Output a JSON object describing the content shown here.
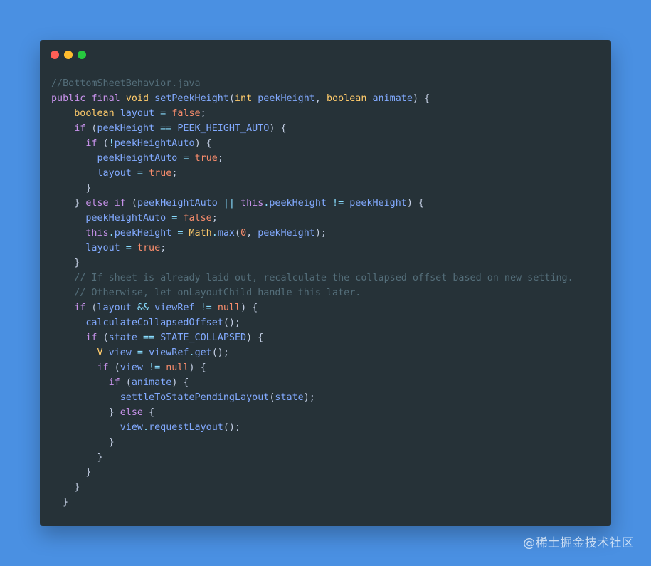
{
  "window": {
    "controls": [
      {
        "name": "close",
        "color": "#ff5f56"
      },
      {
        "name": "minimize",
        "color": "#ffbd2e"
      },
      {
        "name": "maximize",
        "color": "#27c93f"
      }
    ],
    "code_lines": [
      [
        {
          "t": "//BottomSheetBehavior.java",
          "s": "c"
        }
      ],
      [
        {
          "t": "public",
          "s": "k"
        },
        {
          "t": " "
        },
        {
          "t": "final",
          "s": "k"
        },
        {
          "t": " "
        },
        {
          "t": "void",
          "s": "t"
        },
        {
          "t": " "
        },
        {
          "t": "setPeekHeight",
          "s": "f"
        },
        {
          "t": "(",
          "s": "d"
        },
        {
          "t": "int",
          "s": "t"
        },
        {
          "t": " "
        },
        {
          "t": "peekHeight",
          "s": "v"
        },
        {
          "t": ", ",
          "s": "d"
        },
        {
          "t": "boolean",
          "s": "t"
        },
        {
          "t": " "
        },
        {
          "t": "animate",
          "s": "v"
        },
        {
          "t": ") {",
          "s": "d"
        }
      ],
      [
        {
          "t": "    "
        },
        {
          "t": "boolean",
          "s": "t"
        },
        {
          "t": " "
        },
        {
          "t": "layout",
          "s": "v"
        },
        {
          "t": " = ",
          "s": "p"
        },
        {
          "t": "false",
          "s": "n"
        },
        {
          "t": ";",
          "s": "d"
        }
      ],
      [
        {
          "t": "    "
        },
        {
          "t": "if",
          "s": "k"
        },
        {
          "t": " (",
          "s": "d"
        },
        {
          "t": "peekHeight",
          "s": "v"
        },
        {
          "t": " == ",
          "s": "p"
        },
        {
          "t": "PEEK_HEIGHT_AUTO",
          "s": "v"
        },
        {
          "t": ") {",
          "s": "d"
        }
      ],
      [
        {
          "t": "      "
        },
        {
          "t": "if",
          "s": "k"
        },
        {
          "t": " (",
          "s": "d"
        },
        {
          "t": "!",
          "s": "p"
        },
        {
          "t": "peekHeightAuto",
          "s": "v"
        },
        {
          "t": ") {",
          "s": "d"
        }
      ],
      [
        {
          "t": "        "
        },
        {
          "t": "peekHeightAuto",
          "s": "v"
        },
        {
          "t": " = ",
          "s": "p"
        },
        {
          "t": "true",
          "s": "n"
        },
        {
          "t": ";",
          "s": "d"
        }
      ],
      [
        {
          "t": "        "
        },
        {
          "t": "layout",
          "s": "v"
        },
        {
          "t": " = ",
          "s": "p"
        },
        {
          "t": "true",
          "s": "n"
        },
        {
          "t": ";",
          "s": "d"
        }
      ],
      [
        {
          "t": "      "
        },
        {
          "t": "}",
          "s": "d"
        }
      ],
      [
        {
          "t": "    "
        },
        {
          "t": "} ",
          "s": "d"
        },
        {
          "t": "else",
          "s": "k"
        },
        {
          "t": " "
        },
        {
          "t": "if",
          "s": "k"
        },
        {
          "t": " (",
          "s": "d"
        },
        {
          "t": "peekHeightAuto",
          "s": "v"
        },
        {
          "t": " || ",
          "s": "p"
        },
        {
          "t": "this",
          "s": "k"
        },
        {
          "t": ".",
          "s": "p"
        },
        {
          "t": "peekHeight",
          "s": "v"
        },
        {
          "t": " != ",
          "s": "p"
        },
        {
          "t": "peekHeight",
          "s": "v"
        },
        {
          "t": ") {",
          "s": "d"
        }
      ],
      [
        {
          "t": "      "
        },
        {
          "t": "peekHeightAuto",
          "s": "v"
        },
        {
          "t": " = ",
          "s": "p"
        },
        {
          "t": "false",
          "s": "n"
        },
        {
          "t": ";",
          "s": "d"
        }
      ],
      [
        {
          "t": "      "
        },
        {
          "t": "this",
          "s": "k"
        },
        {
          "t": ".",
          "s": "p"
        },
        {
          "t": "peekHeight",
          "s": "v"
        },
        {
          "t": " = ",
          "s": "p"
        },
        {
          "t": "Math",
          "s": "t"
        },
        {
          "t": ".",
          "s": "p"
        },
        {
          "t": "max",
          "s": "f"
        },
        {
          "t": "(",
          "s": "d"
        },
        {
          "t": "0",
          "s": "n"
        },
        {
          "t": ", ",
          "s": "d"
        },
        {
          "t": "peekHeight",
          "s": "v"
        },
        {
          "t": ");",
          "s": "d"
        }
      ],
      [
        {
          "t": "      "
        },
        {
          "t": "layout",
          "s": "v"
        },
        {
          "t": " = ",
          "s": "p"
        },
        {
          "t": "true",
          "s": "n"
        },
        {
          "t": ";",
          "s": "d"
        }
      ],
      [
        {
          "t": "    "
        },
        {
          "t": "}",
          "s": "d"
        }
      ],
      [
        {
          "t": "    "
        },
        {
          "t": "// If sheet is already laid out, recalculate the collapsed offset based on new setting.",
          "s": "c"
        }
      ],
      [
        {
          "t": "    "
        },
        {
          "t": "// Otherwise, let onLayoutChild handle this later.",
          "s": "c"
        }
      ],
      [
        {
          "t": "    "
        },
        {
          "t": "if",
          "s": "k"
        },
        {
          "t": " (",
          "s": "d"
        },
        {
          "t": "layout",
          "s": "v"
        },
        {
          "t": " && ",
          "s": "p"
        },
        {
          "t": "viewRef",
          "s": "v"
        },
        {
          "t": " != ",
          "s": "p"
        },
        {
          "t": "null",
          "s": "n"
        },
        {
          "t": ") {",
          "s": "d"
        }
      ],
      [
        {
          "t": "      "
        },
        {
          "t": "calculateCollapsedOffset",
          "s": "f"
        },
        {
          "t": "();",
          "s": "d"
        }
      ],
      [
        {
          "t": "      "
        },
        {
          "t": "if",
          "s": "k"
        },
        {
          "t": " (",
          "s": "d"
        },
        {
          "t": "state",
          "s": "v"
        },
        {
          "t": " == ",
          "s": "p"
        },
        {
          "t": "STATE_COLLAPSED",
          "s": "v"
        },
        {
          "t": ") {",
          "s": "d"
        }
      ],
      [
        {
          "t": "        "
        },
        {
          "t": "V",
          "s": "t"
        },
        {
          "t": " "
        },
        {
          "t": "view",
          "s": "v"
        },
        {
          "t": " = ",
          "s": "p"
        },
        {
          "t": "viewRef",
          "s": "v"
        },
        {
          "t": ".",
          "s": "p"
        },
        {
          "t": "get",
          "s": "f"
        },
        {
          "t": "();",
          "s": "d"
        }
      ],
      [
        {
          "t": "        "
        },
        {
          "t": "if",
          "s": "k"
        },
        {
          "t": " (",
          "s": "d"
        },
        {
          "t": "view",
          "s": "v"
        },
        {
          "t": " != ",
          "s": "p"
        },
        {
          "t": "null",
          "s": "n"
        },
        {
          "t": ") {",
          "s": "d"
        }
      ],
      [
        {
          "t": "          "
        },
        {
          "t": "if",
          "s": "k"
        },
        {
          "t": " (",
          "s": "d"
        },
        {
          "t": "animate",
          "s": "v"
        },
        {
          "t": ") {",
          "s": "d"
        }
      ],
      [
        {
          "t": "            "
        },
        {
          "t": "settleToStatePendingLayout",
          "s": "f"
        },
        {
          "t": "(",
          "s": "d"
        },
        {
          "t": "state",
          "s": "v"
        },
        {
          "t": ");",
          "s": "d"
        }
      ],
      [
        {
          "t": "          "
        },
        {
          "t": "} ",
          "s": "d"
        },
        {
          "t": "else",
          "s": "k"
        },
        {
          "t": " {",
          "s": "d"
        }
      ],
      [
        {
          "t": "            "
        },
        {
          "t": "view",
          "s": "v"
        },
        {
          "t": ".",
          "s": "p"
        },
        {
          "t": "requestLayout",
          "s": "f"
        },
        {
          "t": "();",
          "s": "d"
        }
      ],
      [
        {
          "t": "          "
        },
        {
          "t": "}",
          "s": "d"
        }
      ],
      [
        {
          "t": "        "
        },
        {
          "t": "}",
          "s": "d"
        }
      ],
      [
        {
          "t": "      "
        },
        {
          "t": "}",
          "s": "d"
        }
      ],
      [
        {
          "t": "    "
        },
        {
          "t": "}",
          "s": "d"
        }
      ],
      [
        {
          "t": "  "
        },
        {
          "t": "}",
          "s": "d"
        }
      ]
    ]
  },
  "watermark": "@稀土掘金技术社区",
  "colors": {
    "background": "#4a90e2",
    "editor_bg": "#263238",
    "keyword": "#c792ea",
    "type": "#ffcb6b",
    "identifier": "#82aaff",
    "operator": "#89ddff",
    "literal": "#f78c6c",
    "comment": "#546e7a"
  }
}
